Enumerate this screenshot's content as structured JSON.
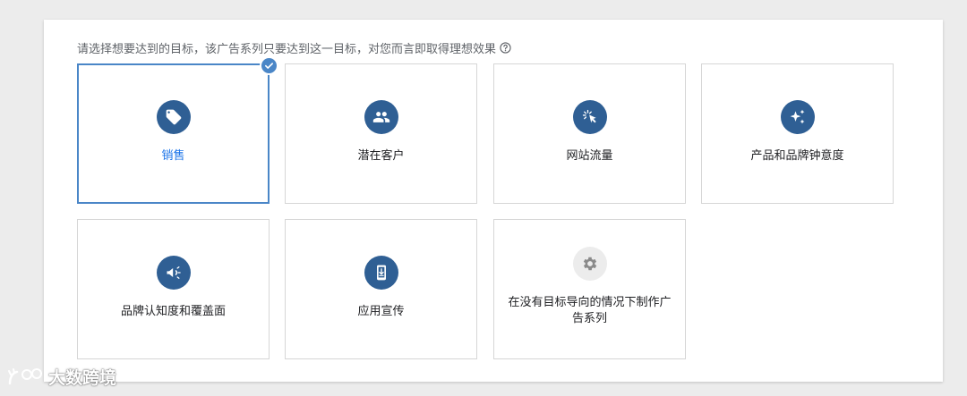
{
  "prompt": {
    "text": "请选择想要达到的目标，该广告系列只要达到这一目标，对您而言即取得理想效果",
    "help_icon": "help-circle-icon"
  },
  "goals": [
    {
      "label": "销售",
      "icon": "tag-icon",
      "selected": true
    },
    {
      "label": "潜在客户",
      "icon": "people-icon",
      "selected": false
    },
    {
      "label": "网站流量",
      "icon": "cursor-click-icon",
      "selected": false
    },
    {
      "label": "产品和品牌钟意度",
      "icon": "sparkle-icon",
      "selected": false
    },
    {
      "label": "品牌认知度和覆盖面",
      "icon": "megaphone-icon",
      "selected": false
    },
    {
      "label": "应用宣传",
      "icon": "phone-download-icon",
      "selected": false
    },
    {
      "label": "在没有目标导向的情况下制作广告系列",
      "icon": "gear-icon",
      "selected": false
    }
  ],
  "watermark": {
    "text": "大数跨境"
  },
  "colors": {
    "accent": "#4a86c7",
    "icon_circle": "#2f5f94",
    "selected_label": "#1a73e8",
    "disabled_circle": "#ececec"
  }
}
